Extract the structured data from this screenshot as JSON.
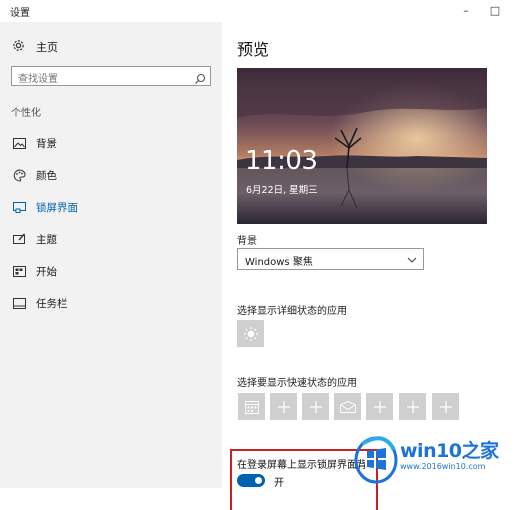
{
  "window": {
    "title": "设置",
    "minimize": "–",
    "maximize": "□"
  },
  "sidebar": {
    "home_label": "主页",
    "search_placeholder": "查找设置",
    "section_label": "个性化",
    "items": [
      {
        "label": "背景",
        "icon": "image-icon",
        "active": false
      },
      {
        "label": "颜色",
        "icon": "palette-icon",
        "active": false
      },
      {
        "label": "锁屏界面",
        "icon": "lock-screen-icon",
        "active": true
      },
      {
        "label": "主题",
        "icon": "theme-icon",
        "active": false
      },
      {
        "label": "开始",
        "icon": "start-icon",
        "active": false
      },
      {
        "label": "任务栏",
        "icon": "taskbar-icon",
        "active": false
      }
    ]
  },
  "main": {
    "title": "预览",
    "preview": {
      "time": "11:03",
      "date": "6月22日, 星期三"
    },
    "background_label": "背景",
    "background_value": "Windows 聚焦",
    "detail_label": "选择显示详细状态的应用",
    "quick_label": "选择要显示快速状态的应用",
    "quick_tiles": [
      "calendar-icon",
      "plus-icon",
      "plus-icon",
      "mail-icon",
      "plus-icon",
      "plus-icon",
      "plus-icon"
    ],
    "lock_bg_label": "在登录屏幕上显示锁屏界面背",
    "toggle_state": "开"
  },
  "watermark": {
    "name": "win10之家",
    "url": "www.2016win10.com"
  },
  "colors": {
    "accent": "#0063b1",
    "highlight_border": "#cc1f1f",
    "sidebar_bg": "#f2f2f2",
    "tile_bg": "#cfcfcf",
    "watermark": "#1e73d8"
  }
}
